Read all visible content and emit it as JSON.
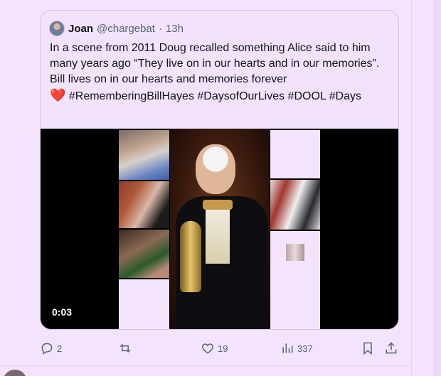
{
  "quoted_post": {
    "author_name": "Joan",
    "author_handle": "@chargebat",
    "separator": "·",
    "time": "13h",
    "text_main": "In a scene from 2011 Doug recalled something Alice said to him many years ago  “They live on in our hearts and in our memories”.  Bill lives on in our hearts and memories forever",
    "heart_emoji": "❤️",
    "hashtags": "#RememberingBillHayes #DaysofOurLives #DOOL #Days",
    "video_time": "0:03"
  },
  "actions": {
    "reply_count": "2",
    "repost_count": "",
    "like_count": "19",
    "view_count": "337"
  },
  "colors": {
    "background": "#f3e4fb",
    "text": "#0f1419",
    "muted": "#536471",
    "heart": "#e0245e"
  }
}
